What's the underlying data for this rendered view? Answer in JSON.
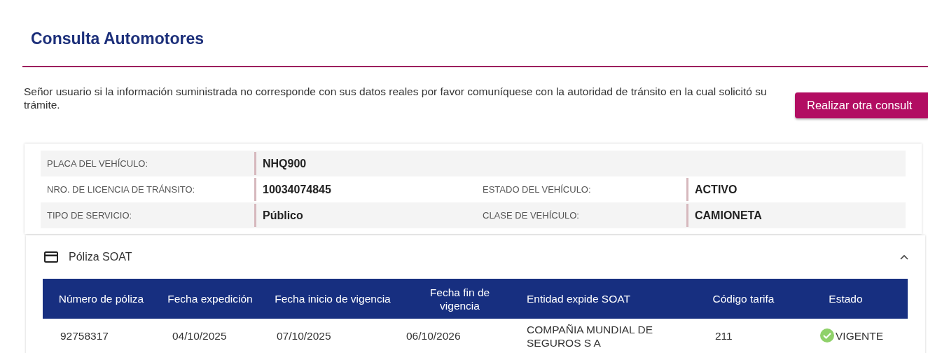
{
  "page": {
    "title": "Consulta Automotores"
  },
  "notice": {
    "text": "Señor usuario si la información suministrada no corresponde con sus datos reales por favor comuníquese con la autoridad de tránsito en la cual solicitó su trámite.",
    "button": "Realizar otra consult"
  },
  "vehicle": [
    {
      "label": "PLACA DEL VEHÍCULO:",
      "value": "NHQ900"
    },
    {
      "label": "NRO. DE LICENCIA DE TRÁNSITO:",
      "value": "10034074845",
      "label_2": "ESTADO DEL VEHÍCULO:",
      "value_2": "ACTIVO"
    },
    {
      "label": "TIPO DE SERVICIO:",
      "value": "Público",
      "label_2": "CLASE DE VEHÍCULO:",
      "value_2": "CAMIONETA"
    }
  ],
  "soat": {
    "title": "Póliza SOAT",
    "expanded": true,
    "columns": [
      "Número de póliza",
      "Fecha expedición",
      "Fecha inicio de vigencia",
      "Fecha fin de vigencia",
      "Entidad expide SOAT",
      "Código tarifa",
      "Estado"
    ],
    "rows": [
      {
        "cells": [
          "92758317",
          "04/10/2025",
          "07/10/2025",
          "06/10/2026",
          "COMPAÑIA MUNDIAL DE SEGUROS S A",
          "211",
          "VIGENTE"
        ]
      }
    ]
  }
}
